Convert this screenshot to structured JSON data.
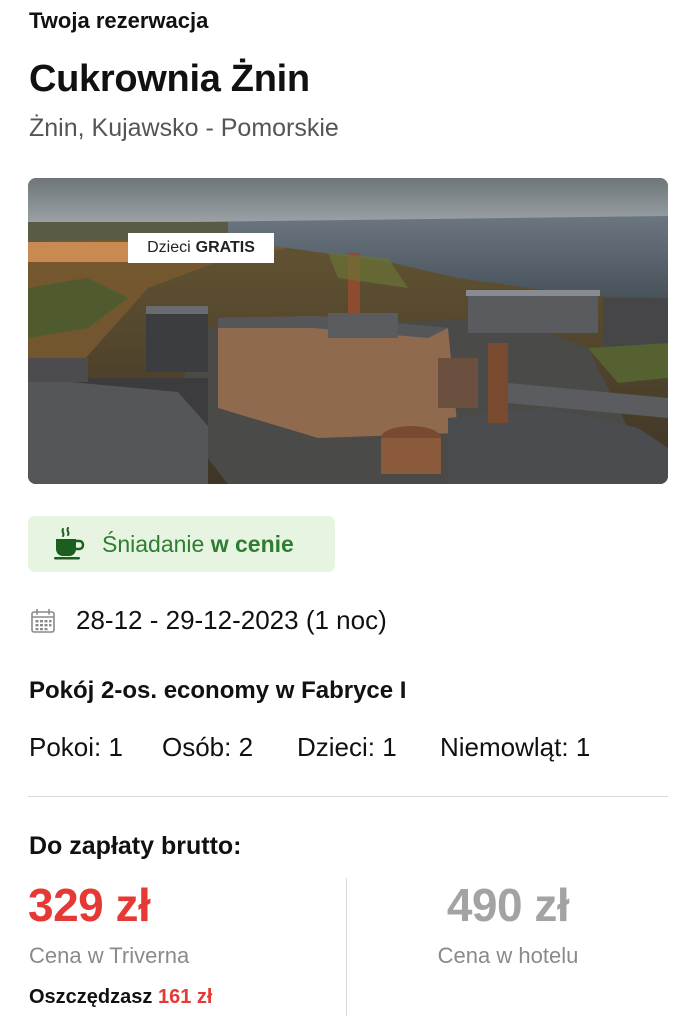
{
  "booking": {
    "section_label": "Twoja rezerwacja",
    "hotel_name": "Cukrownia Żnin",
    "location": "Żnin, Kujawsko - Pomorskie"
  },
  "promo_badge": {
    "text": "Dzieci",
    "strong": "GRATIS"
  },
  "breakfast": {
    "icon": "coffee-cup-icon",
    "text": "Śniadanie",
    "strong": "w cenie",
    "colors": {
      "background": "#e6f4e1",
      "text": "#2e7d32"
    }
  },
  "stay": {
    "icon": "calendar-icon",
    "dates": "28-12 - 29-12-2023 (1 noc)"
  },
  "room": {
    "name": "Pokój 2-os. economy w Fabryce I"
  },
  "occupancy": [
    {
      "label": "Pokoi:",
      "value": "1"
    },
    {
      "label": "Osób:",
      "value": "2"
    },
    {
      "label": "Dzieci:",
      "value": "1"
    },
    {
      "label": "Niemowląt:",
      "value": "1"
    }
  ],
  "payment": {
    "label": "Do zapłaty brutto:",
    "our_price": "329 zł",
    "our_price_caption": "Cena w Triverna",
    "savings_label": "Oszczędzasz",
    "savings_amount": "161 zł",
    "hotel_price": "490 zł",
    "hotel_price_caption": "Cena w hotelu",
    "colors": {
      "accent": "#e53935",
      "muted": "#a3a3a3"
    }
  }
}
